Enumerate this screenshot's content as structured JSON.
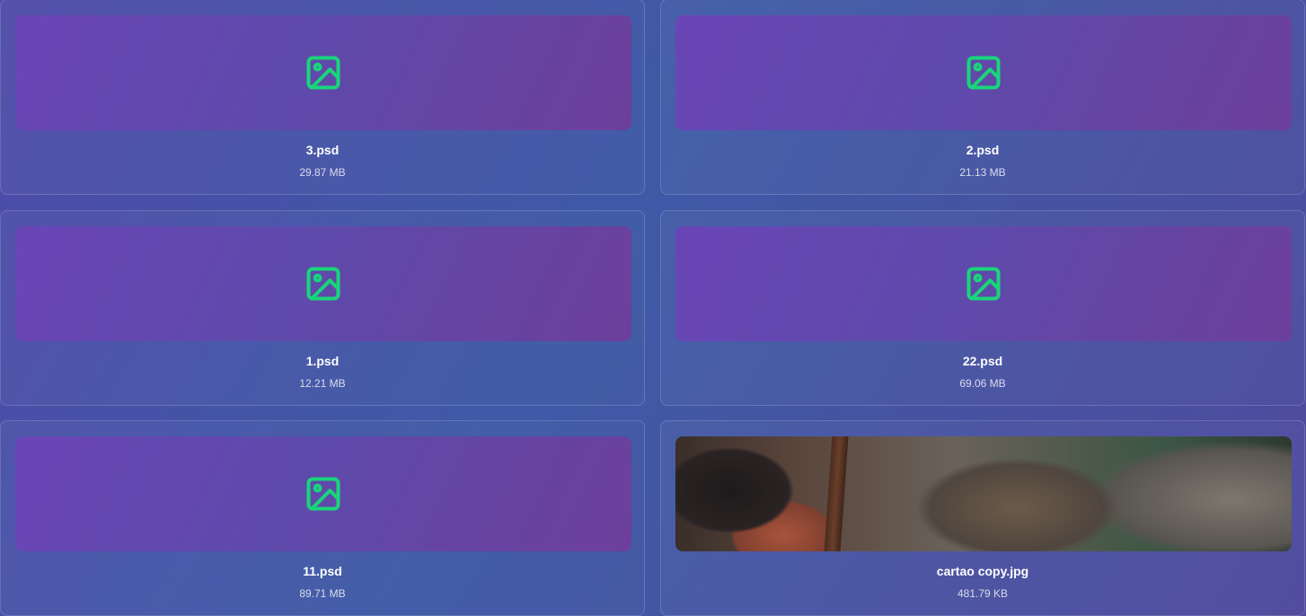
{
  "files": [
    {
      "name": "3.psd",
      "size": "29.87 MB",
      "icon": "image-icon"
    },
    {
      "name": "2.psd",
      "size": "21.13 MB",
      "icon": "image-icon"
    },
    {
      "name": "1.psd",
      "size": "12.21 MB",
      "icon": "image-icon"
    },
    {
      "name": "22.psd",
      "size": "69.06 MB",
      "icon": "image-icon"
    },
    {
      "name": "11.psd",
      "size": "89.71 MB",
      "icon": "image-icon"
    },
    {
      "name": "cartao copy.jpg",
      "size": "481.79 KB",
      "icon": "photo-thumbnail"
    }
  ],
  "colors": {
    "icon": "#19d57a",
    "thumb_purple": "#6a45b7",
    "background_blue": "#3e5aa6"
  }
}
